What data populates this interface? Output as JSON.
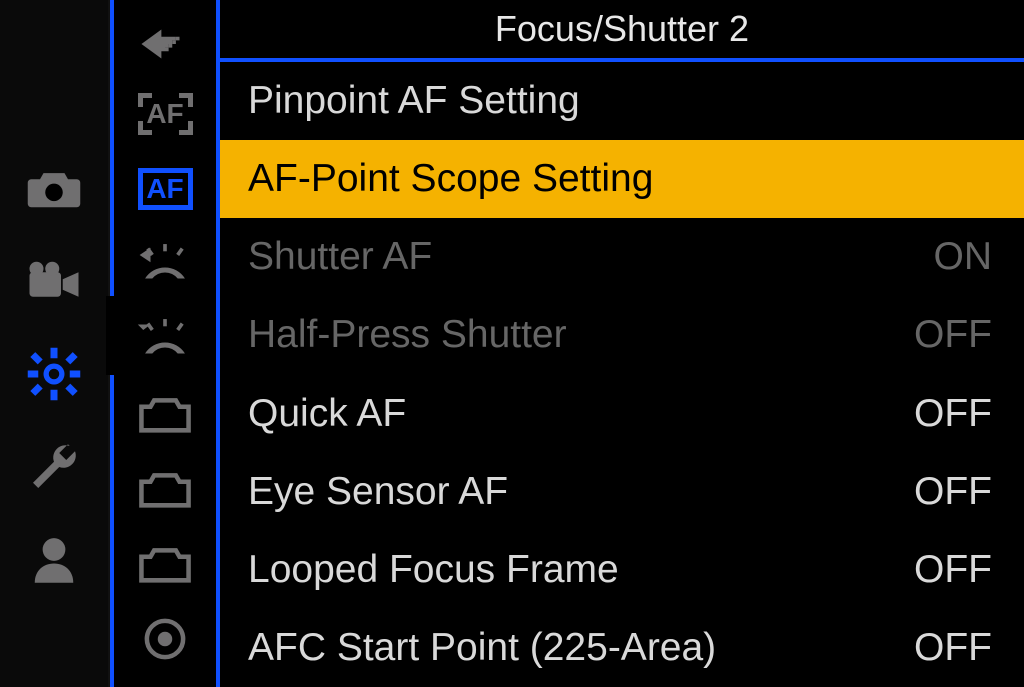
{
  "title": "Focus/Shutter 2",
  "main_sidebar": {
    "items": [
      {
        "name": "photo-icon"
      },
      {
        "name": "video-icon"
      },
      {
        "name": "gear-icon",
        "selected": true
      },
      {
        "name": "wrench-icon"
      },
      {
        "name": "user-icon"
      }
    ]
  },
  "sub_sidebar": {
    "items": [
      {
        "name": "back-icon"
      },
      {
        "name": "af-corners-icon",
        "glyph": "AF"
      },
      {
        "name": "af-full-icon",
        "glyph": "AF",
        "selected": true
      },
      {
        "name": "dial-back-icon"
      },
      {
        "name": "dial-forward-icon"
      },
      {
        "name": "camera-outline-1-icon"
      },
      {
        "name": "camera-outline-2-icon"
      },
      {
        "name": "camera-outline-3-icon"
      },
      {
        "name": "target-icon"
      }
    ]
  },
  "rows": [
    {
      "label": "Pinpoint AF Setting",
      "value": "",
      "state": "normal"
    },
    {
      "label": "AF-Point Scope Setting",
      "value": "",
      "state": "highlight"
    },
    {
      "label": "Shutter AF",
      "value": "ON",
      "state": "dim"
    },
    {
      "label": "Half-Press Shutter",
      "value": "OFF",
      "state": "dim"
    },
    {
      "label": "Quick AF",
      "value": "OFF",
      "state": "normal"
    },
    {
      "label": "Eye Sensor AF",
      "value": "OFF",
      "state": "normal"
    },
    {
      "label": "Looped Focus Frame",
      "value": "OFF",
      "state": "normal"
    },
    {
      "label": "AFC Start Point (225-Area)",
      "value": "OFF",
      "state": "normal"
    }
  ]
}
